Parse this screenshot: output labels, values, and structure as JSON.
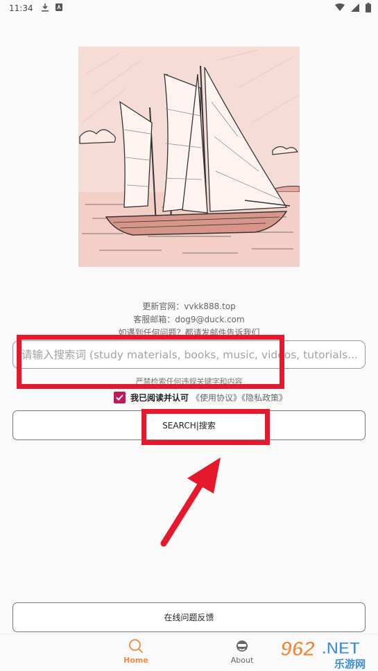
{
  "status_bar": {
    "time": "11:34"
  },
  "info": {
    "line1": "更新官网：vvkk888.top",
    "line2": "客服邮箱：dog9@duck.com",
    "line3": "如遇到任何问题？都请发邮件告诉我们"
  },
  "search": {
    "placeholder": "请输入搜索词 (study materials, books, music, videos, tutorials...)",
    "value": ""
  },
  "notice": "严禁检索任何违规关键字和内容",
  "agreement": {
    "checked": true,
    "text": "我已阅读并认可",
    "links": "《使用协议》《隐私政策》"
  },
  "buttons": {
    "search": "SEARCH|搜索",
    "feedback": "在线问题反馈"
  },
  "tabs": [
    {
      "label": "Home",
      "icon": "search-icon",
      "active": true
    },
    {
      "label": "About",
      "icon": "avatar-icon",
      "active": false
    }
  ],
  "watermark": {
    "text1": "962",
    "text2": ".NET",
    "text3": "乐游网"
  },
  "colors": {
    "annotation": "#e6182c",
    "accent": "#f08a3e",
    "checkbox": "#c2185b",
    "hero_bg": "#f6dcd6"
  }
}
